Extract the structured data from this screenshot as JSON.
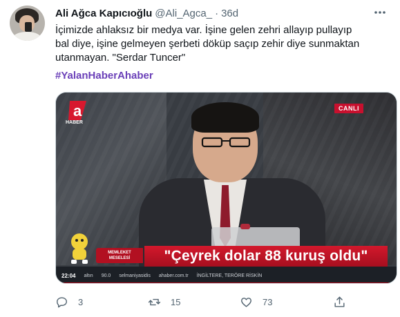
{
  "tweet": {
    "author_name": "Ali Ağca Kapıcıoğlu",
    "handle": "@Ali_Agca_",
    "separator": "·",
    "time": "36d",
    "text_lines": [
      "İçimizde ahlaksız bir medya var. İşine gelen zehri allayıp pullayıp",
      "bal diye, işine gelmeyen şerbeti döküp saçıp zehir diye sunmaktan",
      "utanmayan. \"Serdar Tuncer\""
    ],
    "hashtag": "#YalanHaberAhaber",
    "hashtag_color": "#6a3fb8"
  },
  "media": {
    "logo_letter": "a",
    "logo_sub": "HABER",
    "live_badge": "CANLI",
    "segment_label_top": "MEMLEKET",
    "segment_label_bottom": "MESELESİ",
    "headline": "\"Çeyrek dolar 88 kuruş oldu\"",
    "ticker": {
      "time": "22:04",
      "items": [
        "altın",
        "90.0",
        "selmaniyasidis",
        "ahaber.com.tr",
        "İNGİLTERE, TERÖRE RİSKİN"
      ]
    },
    "colors": {
      "banner_red": "#c8102e",
      "ticker_bg": "#1c2026"
    }
  },
  "actions": {
    "reply_count": "3",
    "retweet_count": "15",
    "like_count": "73",
    "icons": [
      "reply-icon",
      "retweet-icon",
      "like-icon",
      "share-icon"
    ]
  }
}
